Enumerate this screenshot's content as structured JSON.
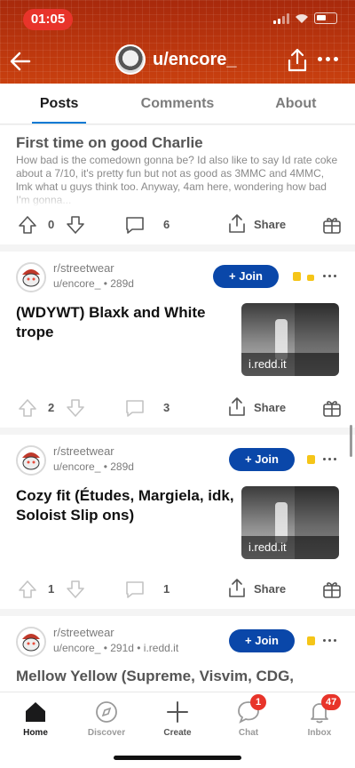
{
  "status_bar": {
    "time": "01:05"
  },
  "header": {
    "username": "u/encore_"
  },
  "tabs": [
    {
      "label": "Posts",
      "active": true
    },
    {
      "label": "Comments",
      "active": false
    },
    {
      "label": "About",
      "active": false
    }
  ],
  "posts": [
    {
      "title": "First time on good Charlie",
      "body": "How bad is the comedown gonna be? Id also like to say Id rate coke about a 7/10, it's pretty fun but not as good as 3MMC and 4MMC, lmk what u guys think too. Anyway, 4am here, wondering how bad I'm gonna...",
      "votes": "0",
      "comments": "6",
      "share_label": "Share"
    },
    {
      "subreddit": "r/streetwear",
      "meta": "u/encore_ • 289d",
      "join_label": "+ Join",
      "title": "(WDYWT) Blaxk and White trope",
      "thumb_caption": "i.redd.it",
      "votes": "2",
      "comments": "3",
      "share_label": "Share"
    },
    {
      "subreddit": "r/streetwear",
      "meta": "u/encore_ • 289d",
      "join_label": "+ Join",
      "title": "Cozy fit (Études, Margiela, idk, Soloist Slip ons)",
      "thumb_caption": "i.redd.it",
      "votes": "1",
      "comments": "1",
      "share_label": "Share"
    },
    {
      "subreddit": "r/streetwear",
      "meta": "u/encore_ • 291d • i.redd.it",
      "join_label": "+ Join",
      "title": "Mellow Yellow (Supreme, Visvim, CDG,"
    }
  ],
  "bottom_nav": [
    {
      "label": "Home",
      "icon": "home-icon",
      "active": true
    },
    {
      "label": "Discover",
      "icon": "compass-icon",
      "active": false
    },
    {
      "label": "Create",
      "icon": "plus-icon",
      "active": false
    },
    {
      "label": "Chat",
      "icon": "chat-icon",
      "badge": "1",
      "active": false
    },
    {
      "label": "Inbox",
      "icon": "bell-icon",
      "badge": "47",
      "active": false
    }
  ],
  "colors": {
    "header": "#b5300e",
    "join_button": "#0a47a9",
    "badge": "#e8342a",
    "tab_indicator": "#0079d3"
  }
}
